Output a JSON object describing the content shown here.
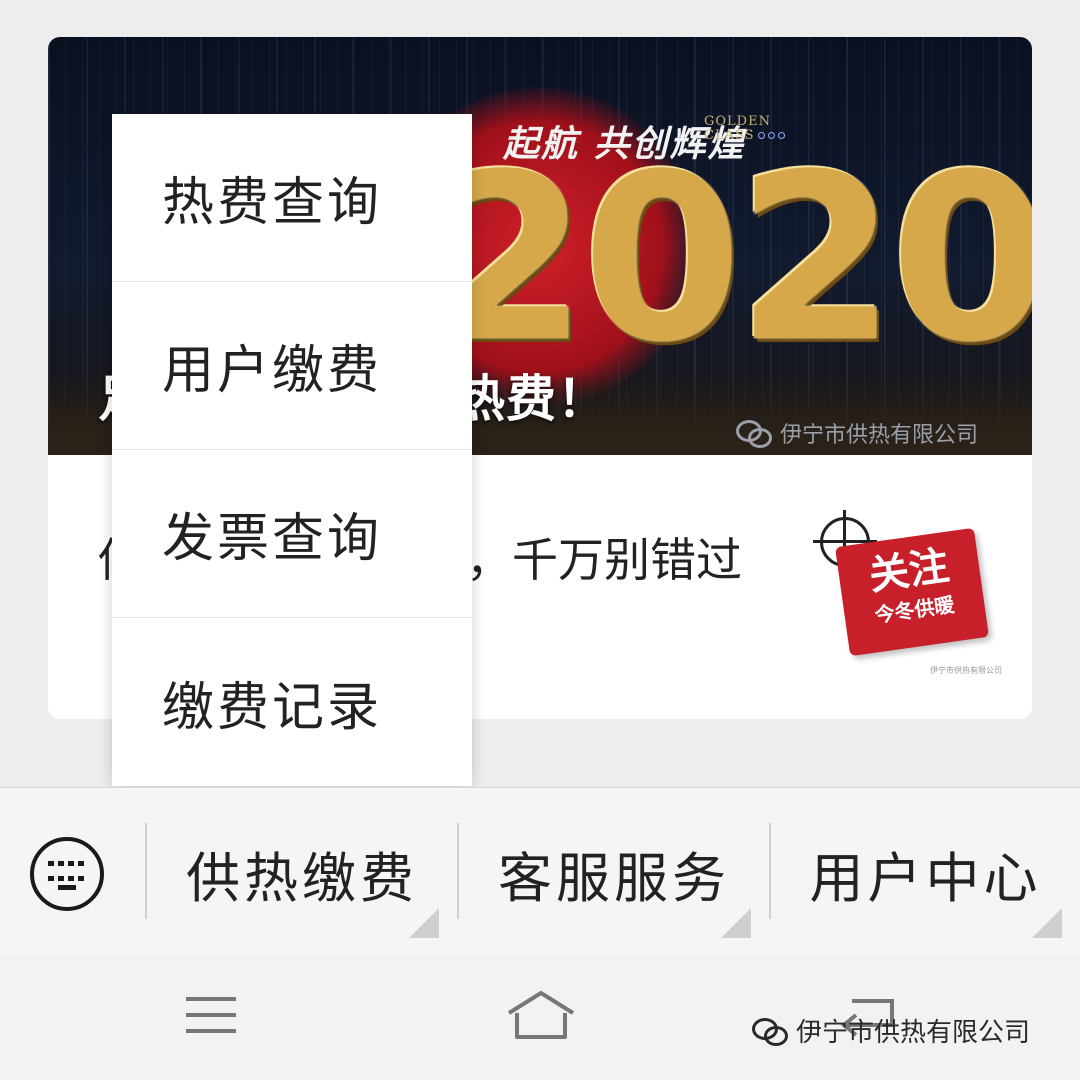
{
  "article": {
    "banner": {
      "slogan": "起航 共创辉煌",
      "golden_line1": "GOLDEN",
      "golden_line2": "CLASS",
      "year": "2020",
      "headline": "足不出户就能缴热费！",
      "watermark": "伊宁市供热有限公司"
    },
    "title": "供热缴费常见问题，千万别错过",
    "thumbnail": {
      "main": "关注",
      "sub": "今冬供暖",
      "caption": "伊宁市供热有限公司"
    }
  },
  "popup_menu": {
    "items": [
      {
        "label": "热费查询"
      },
      {
        "label": "用户缴费"
      },
      {
        "label": "发票查询"
      },
      {
        "label": "缴费记录"
      }
    ]
  },
  "menu_bar": {
    "keyboard_icon": "keyboard-icon",
    "tabs": [
      {
        "label": "供热缴费"
      },
      {
        "label": "客服服务"
      },
      {
        "label": "用户中心"
      }
    ]
  },
  "system_nav": {
    "icons": [
      "menu-icon",
      "home-icon",
      "back-icon"
    ],
    "watermark": "伊宁市供热有限公司"
  },
  "colors": {
    "accent_red": "#c8202a",
    "gold": "#d6a84a"
  }
}
